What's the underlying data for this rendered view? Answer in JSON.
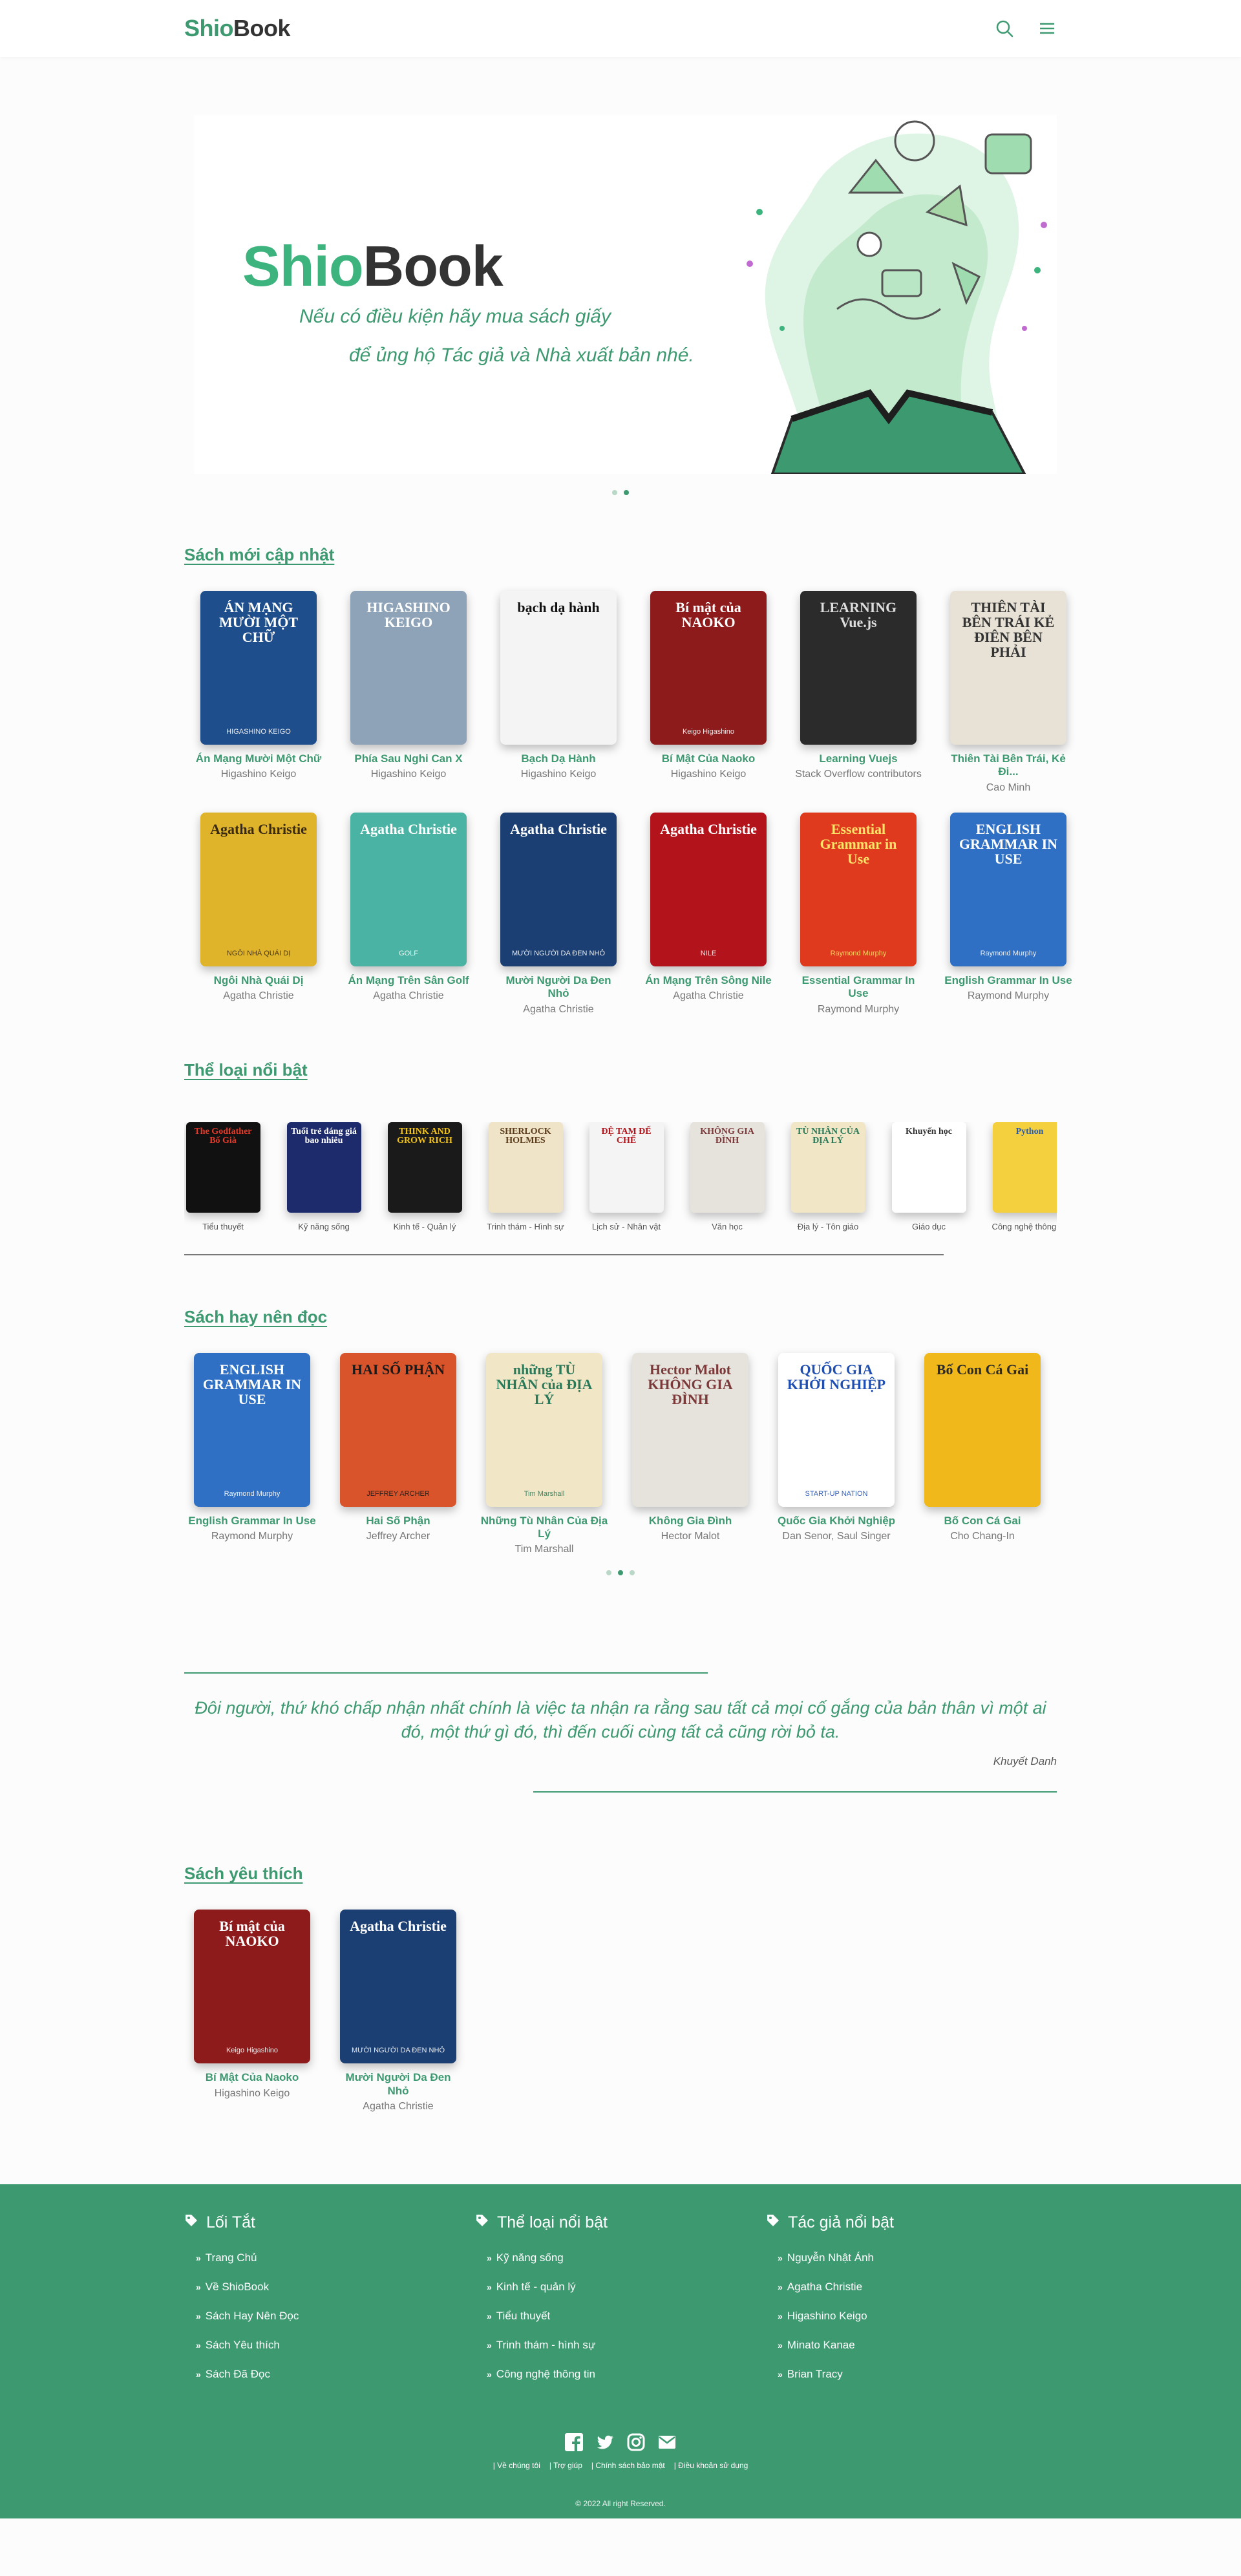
{
  "header": {
    "logo_part1": "Shio",
    "logo_part2": "Book",
    "search_icon": "search-icon",
    "menu_icon": "hamburger-menu-icon"
  },
  "hero": {
    "logo_part1": "Shio",
    "logo_part2": "Book",
    "slogan_line1": "Nếu có điều kiện hãy mua sách giấy",
    "slogan_line2": "để ủng hộ Tác giả và Nhà xuất bản nhé.",
    "active_slide": 2,
    "slide_count": 2
  },
  "new_books": {
    "title": "Sách mới cập nhật",
    "items": [
      {
        "title": "Án Mạng Mười Một Chữ",
        "author": "Higashino Keigo",
        "cover_text": "ÁN MẠNG MƯỜI MỘT CHỮ",
        "cover_sub": "HIGASHINO KEIGO",
        "bg": "#1f4e8c",
        "fg": "#ffffff"
      },
      {
        "title": "Phía Sau Nghi Can X",
        "author": "Higashino Keigo",
        "cover_text": "HIGASHINO KEIGO",
        "cover_sub": "",
        "bg": "#8fa3b8",
        "fg": "#ffffff"
      },
      {
        "title": "Bạch Dạ Hành",
        "author": "Higashino Keigo",
        "cover_text": "bạch dạ hành",
        "cover_sub": "",
        "bg": "#f4f4f4",
        "fg": "#111111"
      },
      {
        "title": "Bí Mật Của Naoko",
        "author": "Higashino Keigo",
        "cover_text": "Bí mật của NAOKO",
        "cover_sub": "Keigo Higashino",
        "bg": "#8e1b1b",
        "fg": "#ffffff"
      },
      {
        "title": "Learning Vuejs",
        "author": "Stack Overflow contributors",
        "cover_text": "LEARNING Vue.js",
        "cover_sub": "",
        "bg": "#2b2b2b",
        "fg": "#dddddd"
      },
      {
        "title": "Thiên Tài Bên Trái, Kẻ Đi...",
        "author": "Cao Minh",
        "cover_text": "THIÊN TÀI BÊN TRÁI KẺ ĐIÊN BÊN PHẢI",
        "cover_sub": "",
        "bg": "#e8e2d6",
        "fg": "#333333"
      },
      {
        "title": "Ngôi Nhà Quái Dị",
        "author": "Agatha Christie",
        "cover_text": "Agatha Christie",
        "cover_sub": "NGÔI NHÀ QUÁI DỊ",
        "bg": "#e0b42a",
        "fg": "#3a2a12"
      },
      {
        "title": "Án Mạng Trên Sân Golf",
        "author": "Agatha Christie",
        "cover_text": "Agatha Christie",
        "cover_sub": "GOLF",
        "bg": "#4bb3a3",
        "fg": "#ffffff"
      },
      {
        "title": "Mười Người Da Đen Nhỏ",
        "author": "Agatha Christie",
        "cover_text": "Agatha Christie",
        "cover_sub": "MƯỜI NGƯỜI DA ĐEN NHỎ",
        "bg": "#1c3f73",
        "fg": "#ffffff"
      },
      {
        "title": "Án Mạng Trên Sông Nile",
        "author": "Agatha Christie",
        "cover_text": "Agatha Christie",
        "cover_sub": "NILE",
        "bg": "#b3141c",
        "fg": "#ffffff"
      },
      {
        "title": "Essential Grammar In Use",
        "author": "Raymond Murphy",
        "cover_text": "Essential Grammar in Use",
        "cover_sub": "Raymond Murphy",
        "bg": "#e03a1e",
        "fg": "#ffe36a"
      },
      {
        "title": "English Grammar In Use",
        "author": "Raymond Murphy",
        "cover_text": "ENGLISH GRAMMAR IN USE",
        "cover_sub": "Raymond Murphy",
        "bg": "#2f6fc4",
        "fg": "#ffffff"
      }
    ]
  },
  "categories": {
    "title": "Thể loại nổi bật",
    "items": [
      {
        "label": "Tiểu thuyết",
        "cover_text": "The Godfather Bố Già",
        "bg": "#111111",
        "fg": "#e23b2b"
      },
      {
        "label": "Kỹ năng sống",
        "cover_text": "Tuổi trẻ đáng giá bao nhiêu",
        "bg": "#1d2a6b",
        "fg": "#ffffff"
      },
      {
        "label": "Kinh tế - Quản lý",
        "cover_text": "THINK AND GROW RICH",
        "bg": "#1a1a1a",
        "fg": "#f2c21a"
      },
      {
        "label": "Trinh thám - Hình sự",
        "cover_text": "SHERLOCK HOLMES",
        "bg": "#efe3c8",
        "fg": "#5a3b1a"
      },
      {
        "label": "Lịch sử - Nhân vật",
        "cover_text": "ĐỆ TAM ĐẾ CHẾ",
        "bg": "#f4f4f4",
        "fg": "#b3141c"
      },
      {
        "label": "Văn học",
        "cover_text": "KHÔNG GIA ĐÌNH",
        "bg": "#e6e2dc",
        "fg": "#7a3a3a"
      },
      {
        "label": "Địa lý - Tôn giáo",
        "cover_text": "TÙ NHÂN CỦA ĐỊA LÝ",
        "bg": "#f1e6c6",
        "fg": "#2a7a5a"
      },
      {
        "label": "Giáo dục",
        "cover_text": "Khuyến học",
        "bg": "#ffffff",
        "fg": "#333333"
      },
      {
        "label": "Công nghệ thông tin",
        "cover_text": "Python",
        "bg": "#f4d03f",
        "fg": "#2a5db0"
      }
    ]
  },
  "recommended": {
    "title": "Sách hay nên đọc",
    "items": [
      {
        "title": "English Grammar In Use",
        "author": "Raymond Murphy",
        "cover_text": "ENGLISH GRAMMAR IN USE",
        "cover_sub": "Raymond Murphy",
        "bg": "#2f6fc4",
        "fg": "#ffffff"
      },
      {
        "title": "Hai Số Phận",
        "author": "Jeffrey Archer",
        "cover_text": "HAI SỐ PHẬN",
        "cover_sub": "JEFFREY ARCHER",
        "bg": "#d9542a",
        "fg": "#1a1a1a"
      },
      {
        "title": "Những Tù Nhân Của Địa Lý",
        "author": "Tim Marshall",
        "cover_text": "những TÙ NHÂN của ĐỊA LÝ",
        "cover_sub": "Tim Marshall",
        "bg": "#f1e6c6",
        "fg": "#2a7a5a"
      },
      {
        "title": "Không Gia Đình",
        "author": "Hector Malot",
        "cover_text": "Hector Malot KHÔNG GIA ĐÌNH",
        "cover_sub": "",
        "bg": "#e6e2dc",
        "fg": "#7a3a3a"
      },
      {
        "title": "Quốc Gia Khởi Nghiệp",
        "author": "Dan Senor, Saul Singer",
        "cover_text": "QUỐC GIA KHỞI NGHIỆP",
        "cover_sub": "START-UP NATION",
        "bg": "#ffffff",
        "fg": "#1f4fb0"
      },
      {
        "title": "Bố Con Cá Gai",
        "author": "Cho Chang-In",
        "cover_text": "Bố Con Cá Gai",
        "cover_sub": "",
        "bg": "#f1b81c",
        "fg": "#2a2a2a"
      }
    ],
    "active_page": 2,
    "page_count": 3
  },
  "quote": {
    "text": "Đôi người, thứ khó chấp nhận nhất chính là việc ta nhận ra rằng sau tất cả mọi cố gắng của bản thân vì một ai đó, một thứ gì đó, thì đến cuối cùng tất cả cũng rời bỏ ta.",
    "author": "Khuyết Danh"
  },
  "favorites": {
    "title": "Sách yêu thích",
    "items": [
      {
        "title": "Bí Mật Của Naoko",
        "author": "Higashino Keigo",
        "cover_text": "Bí mật của NAOKO",
        "cover_sub": "Keigo Higashino",
        "bg": "#8e1b1b",
        "fg": "#ffffff"
      },
      {
        "title": "Mười Người Da Đen Nhỏ",
        "author": "Agatha Christie",
        "cover_text": "Agatha Christie",
        "cover_sub": "MƯỜI NGƯỜI DA ĐEN NHỎ",
        "bg": "#1c3f73",
        "fg": "#ffffff"
      }
    ]
  },
  "footer": {
    "col1": {
      "title": "Lối Tắt",
      "links": [
        "Trang Chủ",
        "Về ShioBook",
        "Sách Hay Nên Đọc",
        "Sách Yêu thích",
        "Sách Đã Đọc"
      ]
    },
    "col2": {
      "title": "Thể loại nổi bật",
      "links": [
        "Kỹ năng sống",
        "Kinh tế - quản lý",
        "Tiểu thuyết",
        "Trinh thám - hình sự",
        "Công nghệ thông tin"
      ]
    },
    "col3": {
      "title": "Tác giả nổi bật",
      "links": [
        "Nguyễn Nhật Ánh",
        "Agatha Christie",
        "Higashino Keigo",
        "Minato Kanae",
        "Brian Tracy"
      ]
    },
    "legal": [
      "| Về chúng tôi",
      "| Trợ giúp",
      "| Chính sách bảo mật",
      "| Điều khoản sử dụng"
    ],
    "copyright": "© 2022 All right Reserved.",
    "social_icons": [
      "facebook-icon",
      "twitter-icon",
      "instagram-icon",
      "email-icon"
    ]
  },
  "colors": {
    "brand": "#3d9970",
    "brand_light": "#3db37d",
    "text": "#333333"
  }
}
